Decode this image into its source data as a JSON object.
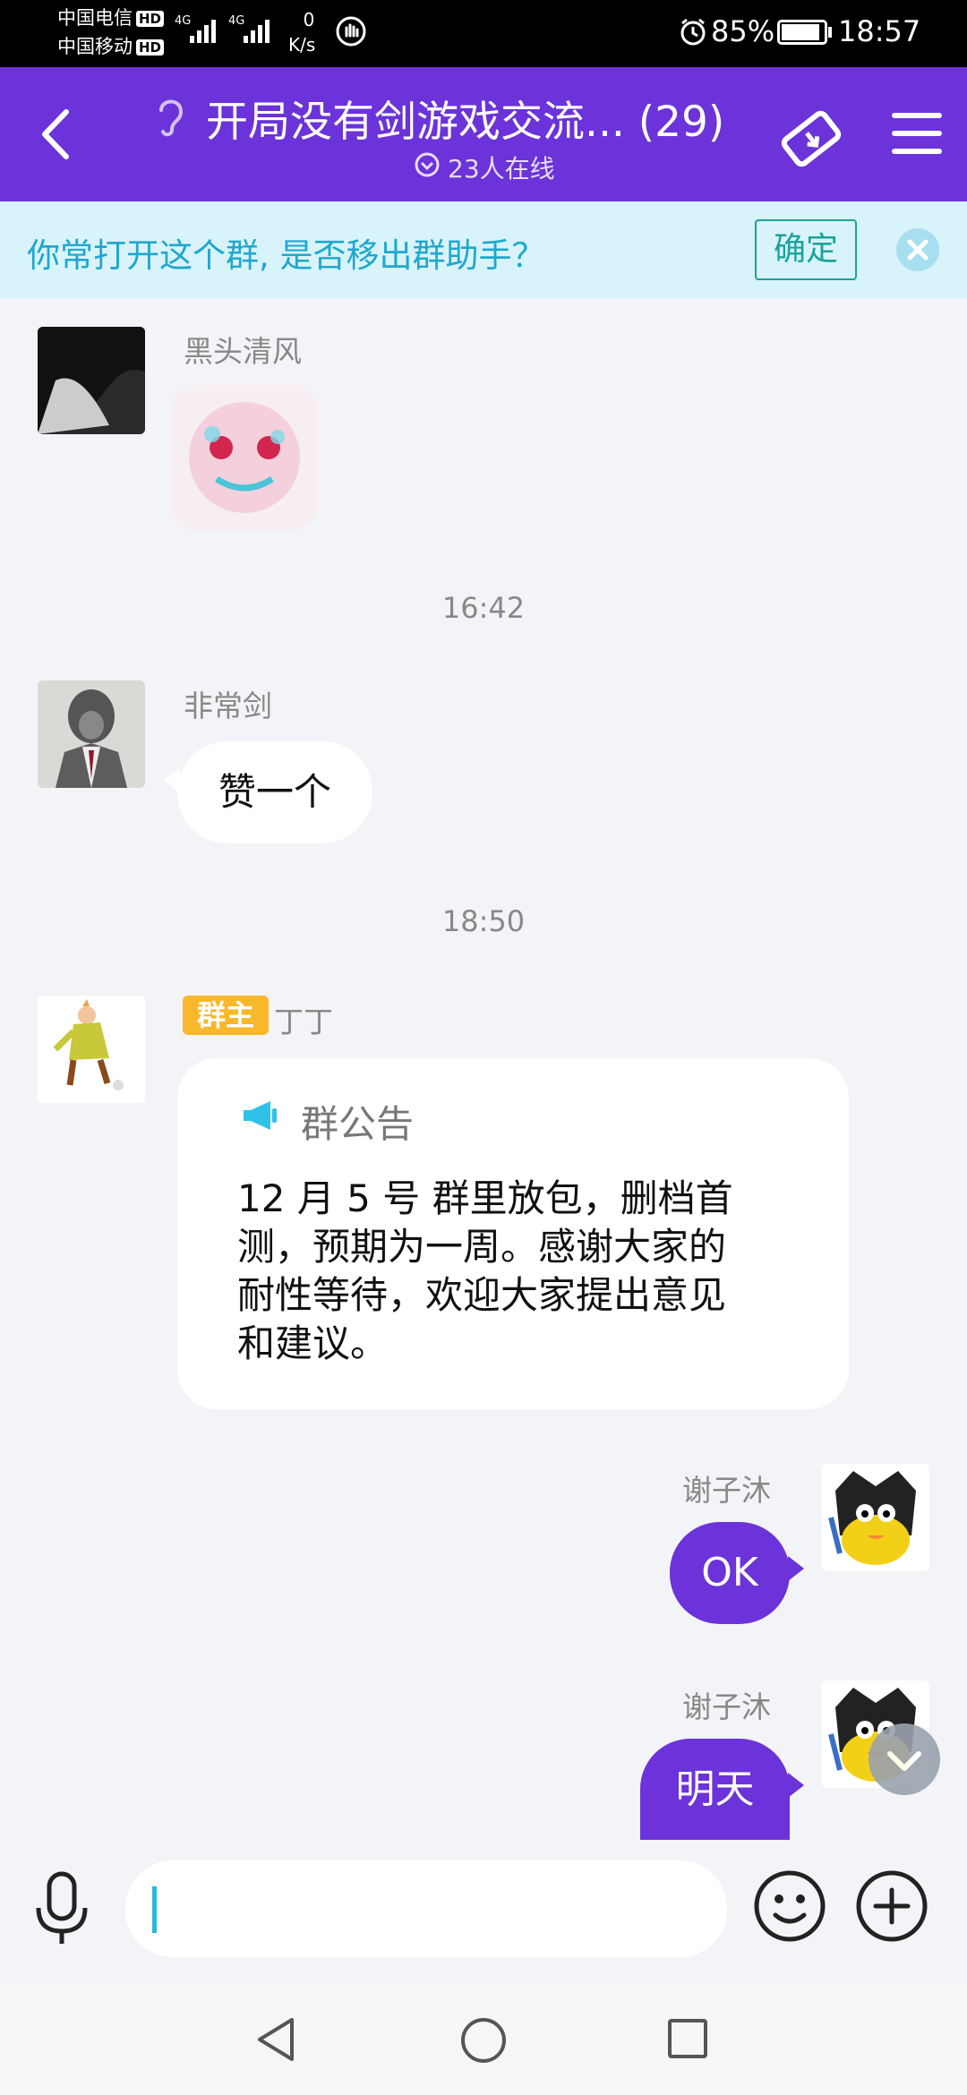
{
  "status_bar": {
    "carrier1": "中国电信",
    "carrier2": "中国移动",
    "hd": "HD",
    "net1": "4G",
    "net2": "4G",
    "speed_value": "0",
    "speed_unit": "K/s",
    "battery": "85%",
    "time": "18:57"
  },
  "header": {
    "title": "开局没有剑游戏交流... (29)",
    "online": "23人在线"
  },
  "banner": {
    "text": "你常打开这个群, 是否移出群助手？",
    "confirm": "确定"
  },
  "messages": [
    {
      "sender": "黑头清风",
      "type": "sticker"
    },
    {
      "timestamp": "16:42"
    },
    {
      "sender": "非常剑",
      "text": "赞一个"
    },
    {
      "timestamp": "18:50"
    },
    {
      "badge": "群主",
      "sender": "丁丁",
      "notice_title": "群公告",
      "notice_lines": [
        "12 月 5 号 群里放包，删档首",
        "测，预期为一周。感谢大家的",
        "耐性等待，欢迎大家提出意见",
        "和建议。"
      ]
    },
    {
      "sender": "谢子沐",
      "text": "OK",
      "self": true
    },
    {
      "sender": "谢子沐",
      "text": "明天",
      "self": true
    }
  ],
  "colors": {
    "accent": "#6b33d9",
    "banner_text": "#1ea8ce",
    "confirm": "#1ba39c",
    "badge": "#f9b82b"
  }
}
